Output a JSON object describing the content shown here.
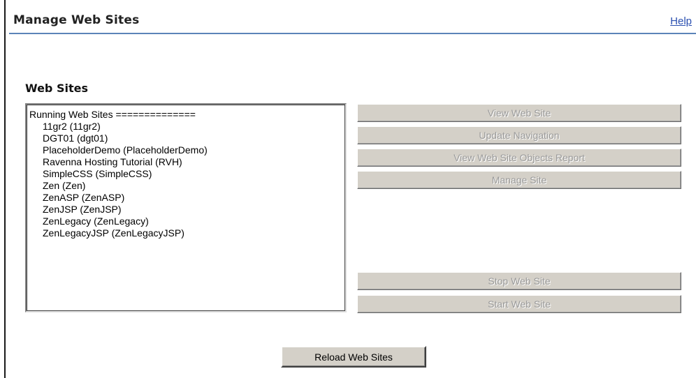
{
  "header": {
    "title": "Manage Web Sites",
    "help_label": "Help"
  },
  "section": {
    "heading": "Web Sites"
  },
  "site_list": {
    "group_label": "Running Web Sites ==============",
    "items": [
      "11gr2 (11gr2)",
      "DGT01 (dgt01)",
      "PlaceholderDemo (PlaceholderDemo)",
      "Ravenna Hosting Tutorial (RVH)",
      "SimpleCSS (SimpleCSS)",
      "Zen (Zen)",
      "ZenASP (ZenASP)",
      "ZenJSP (ZenJSP)",
      "ZenLegacy (ZenLegacy)",
      "ZenLegacyJSP (ZenLegacyJSP)"
    ]
  },
  "actions": {
    "view_site": "View Web Site",
    "update_navigation": "Update Navigation",
    "objects_report": "View Web Site Objects Report",
    "manage_site": "Manage Site",
    "stop_site": "Stop Web Site",
    "start_site": "Start Web Site",
    "reload_sites": "Reload Web Sites"
  },
  "colors": {
    "title_rule": "#5b84b8",
    "link": "#2a4fb0",
    "button_face": "#d4d0c8",
    "disabled_text": "#9a9a9a"
  }
}
